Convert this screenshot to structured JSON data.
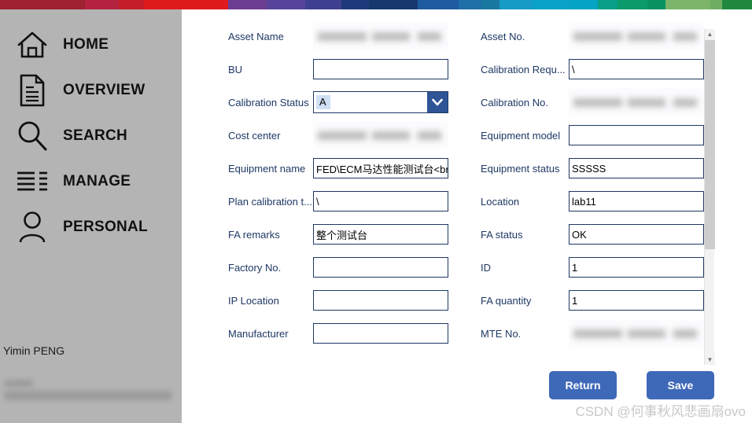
{
  "topbar": {
    "segments": [
      {
        "color": "#9e2232",
        "width": 119
      },
      {
        "color": "#b32341",
        "width": 48
      },
      {
        "color": "#c41f28",
        "width": 35
      },
      {
        "color": "#e01b1b",
        "width": 118
      },
      {
        "color": "#6b3e91",
        "width": 54
      },
      {
        "color": "#57449a",
        "width": 55
      },
      {
        "color": "#3e3f8f",
        "width": 50
      },
      {
        "color": "#1e3a7b",
        "width": 39
      },
      {
        "color": "#16386f",
        "width": 68
      },
      {
        "color": "#1f5ba0",
        "width": 58
      },
      {
        "color": "#1f6fa8",
        "width": 32
      },
      {
        "color": "#18789f",
        "width": 25
      },
      {
        "color": "#169bc6",
        "width": 47
      },
      {
        "color": "#0aa2c8",
        "width": 53
      },
      {
        "color": "#05a3c4",
        "width": 38
      },
      {
        "color": "#089f86",
        "width": 28
      },
      {
        "color": "#0b9a6a",
        "width": 42
      },
      {
        "color": "#089260",
        "width": 25
      },
      {
        "color": "#7cb46a",
        "width": 64
      },
      {
        "color": "#6fae62",
        "width": 16
      },
      {
        "color": "#1f8a3f",
        "width": 42
      }
    ]
  },
  "sidebar": {
    "items": [
      {
        "icon": "home-icon",
        "label": "HOME"
      },
      {
        "icon": "document-icon",
        "label": "OVERVIEW"
      },
      {
        "icon": "search-icon",
        "label": "SEARCH"
      },
      {
        "icon": "list-icon",
        "label": "MANAGE"
      },
      {
        "icon": "person-icon",
        "label": "PERSONAL"
      }
    ],
    "user_name": "Yimin PENG"
  },
  "form": {
    "left_column": [
      {
        "label": "Asset Name",
        "type": "redacted",
        "value": ""
      },
      {
        "label": "BU",
        "type": "text",
        "value": ""
      },
      {
        "label": "Calibration Status",
        "type": "select",
        "value": "A"
      },
      {
        "label": "Cost center",
        "type": "redacted",
        "value": ""
      },
      {
        "label": "Equipment name",
        "type": "text",
        "value": "FED\\ECM马达性能测试台<br>"
      },
      {
        "label": "Plan calibration t...",
        "type": "text",
        "value": "\\"
      },
      {
        "label": "FA remarks",
        "type": "text",
        "value": "整个测试台"
      },
      {
        "label": "Factory No.",
        "type": "text",
        "value": ""
      },
      {
        "label": "IP Location",
        "type": "text",
        "value": ""
      },
      {
        "label": "Manufacturer",
        "type": "text",
        "value": ""
      }
    ],
    "right_column": [
      {
        "label": "Asset No.",
        "type": "redacted",
        "value": ""
      },
      {
        "label": "Calibration Requ...",
        "type": "text",
        "value": "\\"
      },
      {
        "label": "Calibration No.",
        "type": "redacted",
        "value": ""
      },
      {
        "label": "Equipment model",
        "type": "text",
        "value": ""
      },
      {
        "label": "Equipment status",
        "type": "text",
        "value": "SSSSS"
      },
      {
        "label": "Location",
        "type": "text",
        "value": "lab11"
      },
      {
        "label": "FA status",
        "type": "text",
        "value": "OK"
      },
      {
        "label": "ID",
        "type": "text",
        "value": "1"
      },
      {
        "label": "FA quantity",
        "type": "text",
        "value": "1"
      },
      {
        "label": "MTE No.",
        "type": "redacted",
        "value": ""
      }
    ]
  },
  "actions": {
    "return_label": "Return",
    "save_label": "Save"
  },
  "watermark": "CSDN @何事秋风悲画扇ovo",
  "colors": {
    "sidebar_bg": "#b4b4b4",
    "label_text": "#1f3864",
    "field_border": "#1f3864",
    "button_bg": "#3e68b8",
    "select_arrow_bg": "#2f5597",
    "select_value_bg": "#cfe0f5"
  }
}
